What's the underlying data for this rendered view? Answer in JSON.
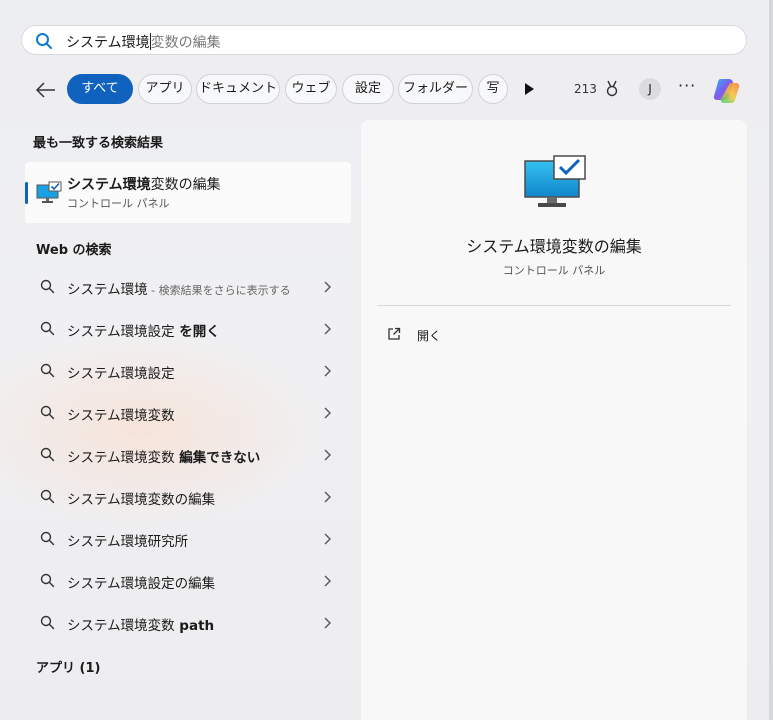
{
  "search": {
    "typed": "システム環境",
    "suggestion": "変数の編集"
  },
  "filters": {
    "tabs": [
      {
        "label": "すべて",
        "active": true
      },
      {
        "label": "アプリ"
      },
      {
        "label": "ドキュメント"
      },
      {
        "label": "ウェブ"
      },
      {
        "label": "設定"
      },
      {
        "label": "フォルダー"
      },
      {
        "label": "写"
      }
    ],
    "points": "213",
    "avatar_initial": "J",
    "more": "···"
  },
  "best_match": {
    "heading": "最も一致する検索結果",
    "name_bold": "システム環境",
    "name_rest": "変数の編集",
    "subtitle": "コントロール パネル"
  },
  "web": {
    "heading": "Web の検索",
    "items": [
      {
        "bold": "システム環境",
        "rest": "",
        "hint": " - 検索結果をさらに表示する"
      },
      {
        "bold": "システム環境設定",
        "rest": " を開く",
        "hint": ""
      },
      {
        "bold": "システム環境設定",
        "rest": "",
        "hint": ""
      },
      {
        "bold": "システム環境変数",
        "rest": "",
        "hint": ""
      },
      {
        "bold": "システム環境変数",
        "rest": " 編集できない",
        "hint": ""
      },
      {
        "bold": "システム環境変数の編集",
        "rest": "",
        "hint": ""
      },
      {
        "bold": "システム環境研究所",
        "rest": "",
        "hint": ""
      },
      {
        "bold": "システム環境設定の編集",
        "rest": "",
        "hint": ""
      },
      {
        "bold": "システム環境変数",
        "rest": " path",
        "hint": ""
      }
    ]
  },
  "apps": {
    "heading": "アプリ (1)"
  },
  "detail": {
    "title": "システム環境変数の編集",
    "subtitle": "コントロール パネル",
    "open_label": "開く"
  },
  "colors": {
    "accent": "#0f62be",
    "monitor_blue": "#1ba1e2"
  }
}
